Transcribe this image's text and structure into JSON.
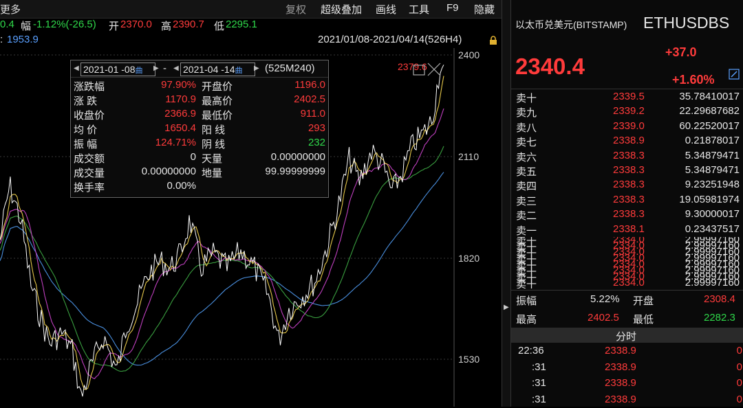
{
  "toolbar": {
    "more_label": "更多",
    "items": [
      "复权",
      "超级叠加",
      "画线",
      "工具",
      "F9",
      "隐藏"
    ]
  },
  "info": {
    "price_tail": "0.4",
    "change_label": "幅",
    "change_value": "-1.12%(-26.5)",
    "open_label": "开",
    "open_value": "2370.0",
    "high_label": "高",
    "high_value": "2390.7",
    "low_label": "低",
    "low_value": "2295.1",
    "ma_prefix": ":",
    "ma_value": "1953.9",
    "range_text": "2021/01/08-2021/04/14(526H4)"
  },
  "chart": {
    "y_labels": [
      "2400",
      "2110",
      "1820",
      "1530"
    ],
    "cursor_price": "2379.6"
  },
  "stats": {
    "start_date": "2021-01 -08",
    "end_date": "2021-04 -14",
    "dash": "-",
    "period": "(525M240)",
    "rows": [
      {
        "l1": "涨跌幅",
        "v1": "97.90%",
        "c1": "red",
        "l2": "开盘价",
        "v2": "1196.0",
        "c2": "red"
      },
      {
        "l1": "涨    跌",
        "v1": "1170.9",
        "c1": "red",
        "l2": "最高价",
        "v2": "2402.5",
        "c2": "red"
      },
      {
        "l1": "收盘价",
        "v1": "2366.9",
        "c1": "red",
        "l2": "最低价",
        "v2": "911.0",
        "c2": "red"
      },
      {
        "l1": "均    价",
        "v1": "1650.4",
        "c1": "red",
        "l2": "阳    线",
        "v2": "293",
        "c2": "red"
      },
      {
        "l1": "振    幅",
        "v1": "124.71%",
        "c1": "red",
        "l2": "阴    线",
        "v2": "232",
        "c2": "green"
      },
      {
        "l1": "成交额",
        "v1": "0",
        "c1": "white",
        "l2": "天量",
        "v2": "0.00000000",
        "c2": "white"
      },
      {
        "l1": "成交量",
        "v1": "0.00000000",
        "c1": "white",
        "l2": "地量",
        "v2": "99.99999999",
        "c2": "white"
      },
      {
        "l1": "换手率",
        "v1": "0.00%",
        "c1": "white",
        "l2": "",
        "v2": "",
        "c2": "white"
      }
    ]
  },
  "quote": {
    "name": "以太币兑美元(BITSTAMP)",
    "symbol": "ETHUSDBS",
    "price": "2340.4",
    "change": "+37.0",
    "change_pct": "+1.60%"
  },
  "orderbook": [
    {
      "label": "卖十",
      "price": "2339.5",
      "qty": "35.78410017"
    },
    {
      "label": "卖九",
      "price": "2339.2",
      "qty": "22.29687682"
    },
    {
      "label": "卖八",
      "price": "2339.0",
      "qty": "60.22520017"
    },
    {
      "label": "卖七",
      "price": "2338.9",
      "qty": "0.21878017"
    },
    {
      "label": "卖六",
      "price": "2338.3",
      "qty": "5.34879471"
    },
    {
      "label": "卖五",
      "price": "2338.3",
      "qty": "5.34879471"
    },
    {
      "label": "卖四",
      "price": "2338.3",
      "qty": "9.23251948"
    },
    {
      "label": "卖三",
      "price": "2338.3",
      "qty": "19.05981974"
    },
    {
      "label": "卖二",
      "price": "2338.3",
      "qty": "9.30000017"
    },
    {
      "label": "卖一",
      "price": "2338.1",
      "qty": "0.23437517"
    }
  ],
  "overlap": {
    "label": "卖十",
    "price": "2334.0",
    "qty": "2.99997160"
  },
  "summary": {
    "amp_label": "振幅",
    "amp_value": "5.22%",
    "open_label": "开盘",
    "open_value": "2308.4",
    "high_label": "最高",
    "high_value": "2402.5",
    "low_label": "最低",
    "low_value": "2282.3"
  },
  "ticks": {
    "header": "分时",
    "rows": [
      {
        "time": "22:36",
        "price": "2338.9",
        "qty": "0"
      },
      {
        "time": ":31",
        "price": "2338.9",
        "qty": "0"
      },
      {
        "time": ":31",
        "price": "2338.9",
        "qty": "0"
      },
      {
        "time": ":31",
        "price": "2338.9",
        "qty": "0"
      }
    ]
  },
  "colors": {
    "up": "#ff3b3b",
    "down": "#2fd84a",
    "price_line": "#ffffff",
    "ma_yellow": "#e6c84a",
    "ma_purple": "#c040c0",
    "ma_green": "#3aa040",
    "ma_blue": "#4a90e0"
  }
}
